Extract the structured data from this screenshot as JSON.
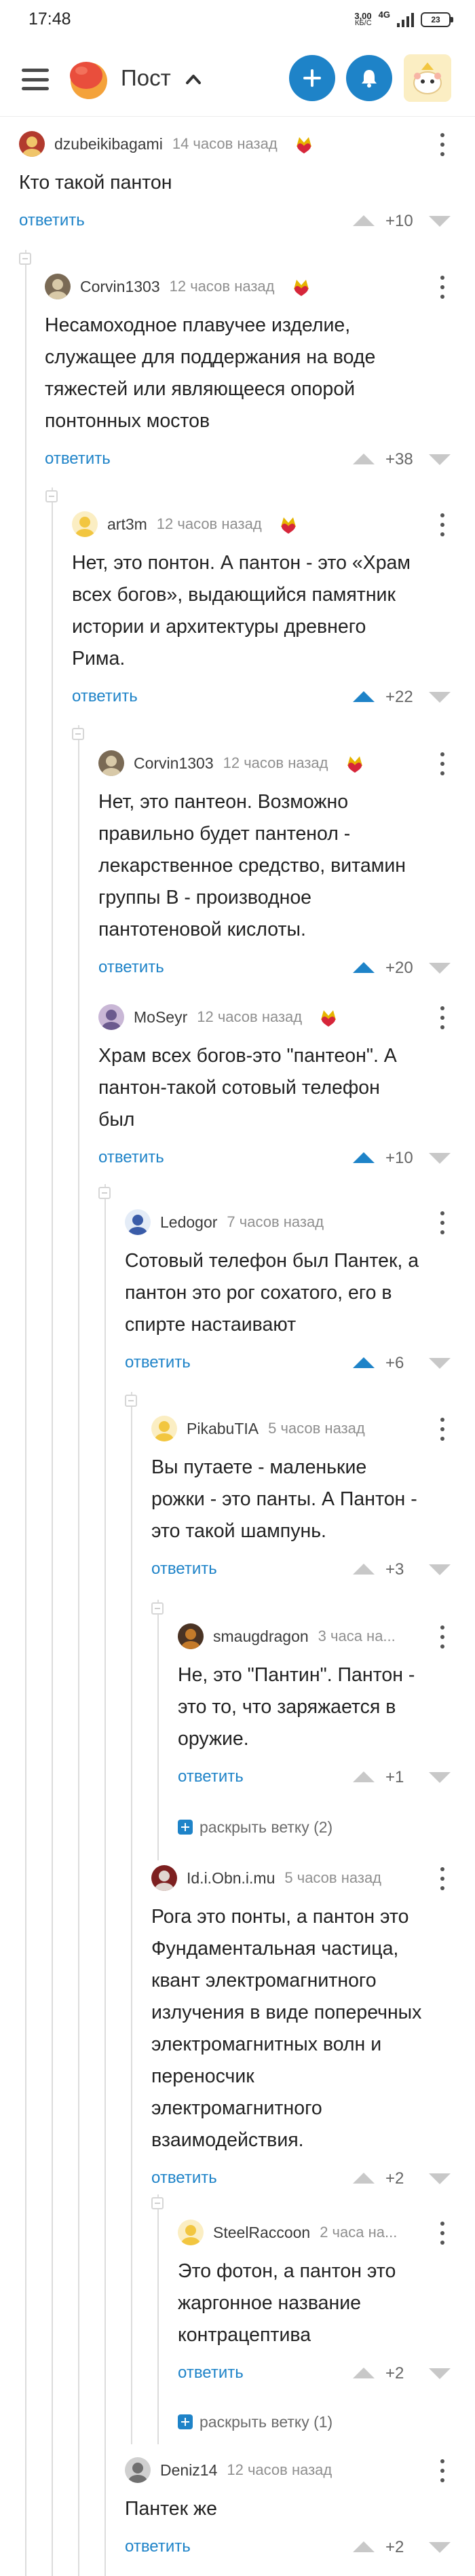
{
  "status_bar": {
    "time": "17:48",
    "net_speed_value": "3,00",
    "net_speed_unit": "КБ/С",
    "signal_label": "4G",
    "battery": "23"
  },
  "header": {
    "title": "Пост",
    "brand_color": "#1e83c8",
    "icons": [
      "menu-icon",
      "logo-icon",
      "chevron-up-icon",
      "plus-icon",
      "bell-icon",
      "avatar"
    ]
  },
  "comments": [
    {
      "user": "dzubeikibagami",
      "time": "14 часов назад",
      "text": "Кто такой пантон",
      "reply": "ответить",
      "rating": "+10",
      "up_active": false
    },
    {
      "user": "Corvin1303",
      "time": "12 часов назад",
      "text": "Несамоходное плавучее изделие,\nслужащее для поддержания на воде\nтяжестей или являющееся опорой\nпонтонных мостов",
      "reply": "ответить",
      "rating": "+38",
      "up_active": false
    },
    {
      "user": "art3m",
      "time": "12 часов назад",
      "text": "Нет, это понтон. А пантон - это «Храм\nвсех богов», выдающийся памятник\nистории и архитектуры древнего\nРима.",
      "reply": "ответить",
      "rating": "+22",
      "up_active": true
    },
    {
      "user": "Corvin1303",
      "time": "12 часов назад",
      "text": "Нет, это пантеон. Возможно\nправильно будет пантенол -\nлекарственное средство, витамин\nгруппы В - производное\nпантотеновой кислоты.",
      "reply": "ответить",
      "rating": "+20",
      "up_active": true
    },
    {
      "user": "MoSeyr",
      "time": "12 часов назад",
      "text": "Храм всех богов-это \"пантеон\". А\nпантон-такой сотовый телефон\nбыл",
      "reply": "ответить",
      "rating": "+10",
      "up_active": true
    },
    {
      "user": "Ledogor",
      "time": "7 часов назад",
      "text": "Сотовый телефон был Пантек, а\nпантон это рог сохатого, его в\nспирте настаивают",
      "reply": "ответить",
      "rating": "+6",
      "up_active": true
    },
    {
      "user": "PikabuTIA",
      "time": "5 часов назад",
      "text": "Вы путаете - маленькие\nрожки - это панты. А Пантон -\nэто такой шампунь.",
      "reply": "ответить",
      "rating": "+3",
      "up_active": false
    },
    {
      "user": "smaugdragon",
      "time": "3 часа на...",
      "text": "Не, это \"Пантин\". Пантон -\nэто то, что заряжается в\nоружие.",
      "reply": "ответить",
      "rating": "+1",
      "up_active": false
    },
    {
      "user": "Id.i.Obn.i.mu",
      "time": "5 часов назад",
      "text": "Рога это понты, а пантон это\nФундаментальная частица,\nквант электромагнитного\nизлучения в виде поперечных\nэлектромагнитных волн и\nпереносчик\nэлектромагнитного\nвзаимодействия.",
      "reply": "ответить",
      "rating": "+2",
      "up_active": false
    },
    {
      "user": "SteelRaccoon",
      "time": "2 часа на...",
      "text": "Это фотон, а пантон это\nжаргонное название\nконтрацептива",
      "reply": "ответить",
      "rating": "+2",
      "up_active": false
    },
    {
      "user": "Deniz14",
      "time": "12 часов назад",
      "text": "Пантек же",
      "reply": "ответить",
      "rating": "+2",
      "up_active": false
    }
  ],
  "expand_links": [
    {
      "label": "раскрыть ветку (2)"
    },
    {
      "label": "раскрыть ветку (1)"
    }
  ],
  "colors": {
    "upvote_active": "#1e83c8",
    "upvote_inactive": "#c8c8c8",
    "reply_link": "#1e83c8",
    "thread_line": "#dcdcdc"
  }
}
